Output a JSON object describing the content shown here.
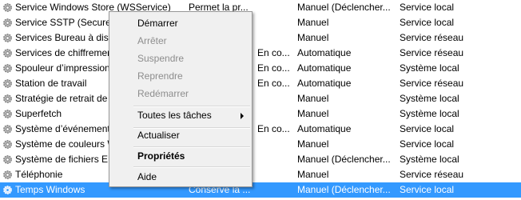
{
  "services": [
    {
      "name": "Service Windows Store (WSService)",
      "description": "Permet la pr...",
      "status": "",
      "startup": "Manuel (Déclencher...",
      "logon": "Service local"
    },
    {
      "name": "Service SSTP (Secure Socket Tunneling Protocol)",
      "description": "",
      "status": "",
      "startup": "Manuel",
      "logon": "Service local"
    },
    {
      "name": "Services Bureau à distance",
      "description": "",
      "status": "",
      "startup": "Manuel",
      "logon": "Service réseau"
    },
    {
      "name": "Services de chiffrement",
      "description": "",
      "status": "En co...",
      "startup": "Automatique",
      "logon": "Service réseau"
    },
    {
      "name": "Spouleur d’impression",
      "description": "",
      "status": "En co...",
      "startup": "Automatique",
      "logon": "Système local"
    },
    {
      "name": "Station de travail",
      "description": "",
      "status": "En co...",
      "startup": "Automatique",
      "logon": "Service réseau"
    },
    {
      "name": "Stratégie de retrait de la carte à puce",
      "description": "",
      "status": "",
      "startup": "Manuel",
      "logon": "Système local"
    },
    {
      "name": "Superfetch",
      "description": "",
      "status": "",
      "startup": "Manuel",
      "logon": "Système local"
    },
    {
      "name": "Système d’événement COM+",
      "description": "",
      "status": "En co...",
      "startup": "Automatique",
      "logon": "Service local"
    },
    {
      "name": "Système de couleurs Windows",
      "description": "",
      "status": "",
      "startup": "Manuel",
      "logon": "Service local"
    },
    {
      "name": "Système de fichiers EFS",
      "description": "",
      "status": "",
      "startup": "Manuel (Déclencher...",
      "logon": "Système local"
    },
    {
      "name": "Téléphonie",
      "description": "",
      "status": "",
      "startup": "Manuel",
      "logon": "Service réseau"
    },
    {
      "name": "Temps Windows",
      "description": "Conserve la ...",
      "status": "",
      "startup": "Manuel (Déclencher...",
      "logon": "Service local"
    }
  ],
  "context_menu": {
    "start": "Démarrer",
    "stop": "Arrêter",
    "pause": "Suspendre",
    "resume": "Reprendre",
    "restart": "Redémarrer",
    "all_tasks": "Toutes les tâches",
    "refresh": "Actualiser",
    "properties": "Propriétés",
    "help": "Aide"
  },
  "colors": {
    "selection": "#3399ff",
    "menu_bg": "#f0f0f0",
    "disabled_text": "#8d8d8d"
  },
  "icons": {
    "service": "gear-icon",
    "submenu": "chevron-right-icon"
  }
}
